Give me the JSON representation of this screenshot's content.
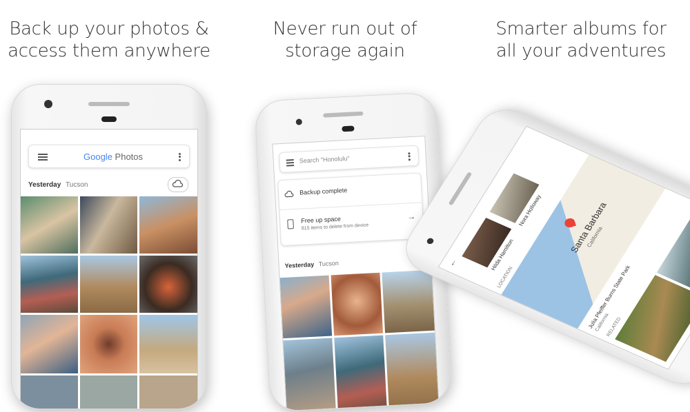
{
  "captions": [
    {
      "line1": "Back up your photos &",
      "line2": "access them anywhere"
    },
    {
      "line1": "Never run out of",
      "line2": "storage again"
    },
    {
      "line1": "Smarter albums for",
      "line2": "all your adventures"
    }
  ],
  "phone1": {
    "brand_google": "Google",
    "brand_photos": "Photos",
    "date_label": "Yesterday",
    "location": "Tucson",
    "icons": [
      "menu-icon",
      "more-vert-icon",
      "cloud-check-icon"
    ]
  },
  "phone2": {
    "search_placeholder": "Search \"Honolulu\"",
    "backup_status": "Backup complete",
    "free_title": "Free up space",
    "free_sub": "815 items to delete from device",
    "date_label": "Yesterday",
    "location": "Tucson",
    "icons": [
      "menu-icon",
      "more-vert-icon",
      "cloud-done-icon",
      "phone-icon",
      "arrow-right-icon"
    ]
  },
  "phone3": {
    "people": [
      "Hilda Hamilton",
      "Nora Holloway"
    ],
    "location_header": "LOCATION",
    "map_city": "Santa Barbara",
    "map_state": "California",
    "park_name": "Julia Pfeiffer Burns State Park",
    "park_state": "California",
    "related_header": "RELATED",
    "icons": [
      "back-arrow-icon",
      "map-pin-icon"
    ]
  },
  "colors": {
    "google_blue": "#4285F4",
    "google_red": "#EA4335",
    "google_yellow": "#FBBC05",
    "google_green": "#34A853"
  }
}
